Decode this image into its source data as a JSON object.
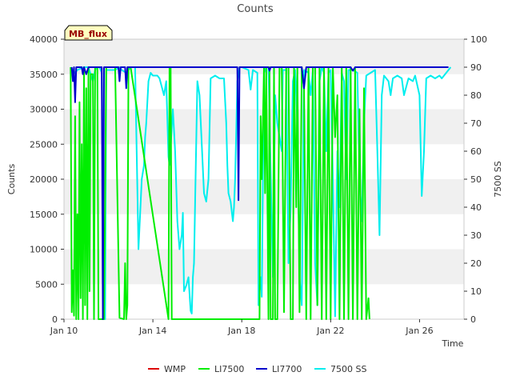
{
  "chart_data": {
    "type": "line",
    "title": "Counts",
    "xlabel": "Time",
    "ylabel": "Counts",
    "y2label": "7500 SS",
    "ylim": [
      0,
      40000
    ],
    "y2lim": [
      0,
      100
    ],
    "xlim": [
      10.0,
      28.0
    ],
    "x_units": "day of January",
    "yticks": [
      0,
      5000,
      10000,
      15000,
      20000,
      25000,
      30000,
      35000,
      40000
    ],
    "y2ticks": [
      0,
      10,
      20,
      30,
      40,
      50,
      60,
      70,
      80,
      90,
      100
    ],
    "xticks": [
      {
        "value": 10,
        "label": "Jan 10"
      },
      {
        "value": 14,
        "label": "Jan 14"
      },
      {
        "value": 18,
        "label": "Jan 18"
      },
      {
        "value": 22,
        "label": "Jan 22"
      },
      {
        "value": 26,
        "label": "Jan 26"
      }
    ],
    "grid": "horizontal bands",
    "legend_position": "bottom",
    "annotation": "MB_flux",
    "series": [
      {
        "name": "WMP",
        "color": "#dd0000",
        "axis": "left",
        "points": []
      },
      {
        "name": "LI7500",
        "color": "#00ee00",
        "axis": "left",
        "points": [
          [
            10.3,
            36000
          ],
          [
            10.35,
            1000
          ],
          [
            10.4,
            7000
          ],
          [
            10.45,
            500
          ],
          [
            10.5,
            29000
          ],
          [
            10.55,
            0
          ],
          [
            10.6,
            15000
          ],
          [
            10.65,
            0
          ],
          [
            10.7,
            31000
          ],
          [
            10.75,
            3000
          ],
          [
            10.8,
            25000
          ],
          [
            10.85,
            0
          ],
          [
            10.9,
            36000
          ],
          [
            10.95,
            2000
          ],
          [
            11.0,
            33000
          ],
          [
            11.05,
            0
          ],
          [
            11.1,
            36000
          ],
          [
            11.15,
            4000
          ],
          [
            11.2,
            35000
          ],
          [
            11.3,
            35000
          ],
          [
            11.35,
            0
          ],
          [
            11.4,
            36000
          ],
          [
            11.5,
            36000
          ],
          [
            11.55,
            0
          ],
          [
            11.8,
            0
          ],
          [
            11.9,
            36000
          ],
          [
            12.2,
            36000
          ],
          [
            12.3,
            36000
          ],
          [
            12.5,
            200
          ],
          [
            12.7,
            0
          ],
          [
            12.75,
            8000
          ],
          [
            12.8,
            0
          ],
          [
            12.85,
            2000
          ],
          [
            12.9,
            36000
          ],
          [
            13.0,
            36000
          ],
          [
            14.7,
            0
          ],
          [
            14.75,
            36000
          ],
          [
            14.8,
            36000
          ],
          [
            14.85,
            0
          ],
          [
            18.8,
            0
          ],
          [
            18.85,
            29000
          ],
          [
            18.9,
            20000
          ],
          [
            19.0,
            36000
          ],
          [
            19.05,
            18000
          ],
          [
            19.1,
            36000
          ],
          [
            19.2,
            0
          ],
          [
            19.25,
            36000
          ],
          [
            19.3,
            0
          ],
          [
            19.4,
            0
          ],
          [
            19.45,
            36000
          ],
          [
            19.5,
            0
          ],
          [
            19.6,
            0
          ],
          [
            19.7,
            36000
          ],
          [
            19.8,
            36000
          ],
          [
            19.9,
            1000
          ],
          [
            20.0,
            36000
          ],
          [
            20.1,
            36000
          ],
          [
            20.2,
            0
          ],
          [
            20.3,
            0
          ],
          [
            20.35,
            36000
          ],
          [
            20.45,
            16000
          ],
          [
            20.5,
            36000
          ],
          [
            20.6,
            1000
          ],
          [
            20.7,
            36000
          ],
          [
            20.8,
            33000
          ],
          [
            20.9,
            0
          ],
          [
            21.0,
            36000
          ],
          [
            21.1,
            0
          ],
          [
            21.2,
            36000
          ],
          [
            21.3,
            36000
          ],
          [
            21.4,
            2000
          ],
          [
            21.5,
            36000
          ],
          [
            21.6,
            0
          ],
          [
            21.7,
            36000
          ],
          [
            21.8,
            0
          ],
          [
            21.9,
            36000
          ],
          [
            22.0,
            0
          ],
          [
            22.1,
            36000
          ],
          [
            22.2,
            26000
          ],
          [
            22.3,
            32000
          ],
          [
            22.4,
            0
          ],
          [
            22.5,
            36000
          ],
          [
            22.6,
            0
          ],
          [
            22.7,
            36000
          ],
          [
            22.8,
            0
          ],
          [
            22.9,
            36000
          ],
          [
            23.0,
            0
          ],
          [
            23.1,
            36000
          ],
          [
            23.2,
            0
          ],
          [
            23.3,
            30000
          ],
          [
            23.4,
            0
          ],
          [
            23.5,
            33000
          ],
          [
            23.6,
            0
          ],
          [
            23.7,
            3000
          ],
          [
            23.75,
            0
          ]
        ]
      },
      {
        "name": "LI7700",
        "color": "#0000cc",
        "axis": "left",
        "points": [
          [
            10.35,
            36000
          ],
          [
            10.4,
            34000
          ],
          [
            10.45,
            36000
          ],
          [
            10.5,
            31000
          ],
          [
            10.55,
            36000
          ],
          [
            10.8,
            36000
          ],
          [
            10.85,
            35000
          ],
          [
            10.9,
            36000
          ],
          [
            11.0,
            35000
          ],
          [
            11.1,
            36000
          ],
          [
            11.2,
            36000
          ],
          [
            11.3,
            36000
          ],
          [
            11.5,
            36000
          ],
          [
            11.6,
            36000
          ],
          [
            11.7,
            36000
          ],
          [
            11.75,
            0
          ],
          [
            11.8,
            36000
          ],
          [
            12.45,
            36000
          ],
          [
            12.5,
            34000
          ],
          [
            12.55,
            36000
          ],
          [
            12.75,
            36000
          ],
          [
            12.8,
            33000
          ],
          [
            12.85,
            36000
          ],
          [
            17.8,
            36000
          ],
          [
            17.85,
            17000
          ],
          [
            17.9,
            36000
          ],
          [
            19.2,
            36000
          ],
          [
            19.25,
            35500
          ],
          [
            19.3,
            36000
          ],
          [
            20.7,
            36000
          ],
          [
            20.8,
            33000
          ],
          [
            20.9,
            36000
          ],
          [
            22.9,
            36000
          ],
          [
            23.0,
            35500
          ],
          [
            23.1,
            36000
          ],
          [
            27.3,
            36000
          ]
        ]
      },
      {
        "name": "7500 SS",
        "color": "#00eeee",
        "axis": "right",
        "points": [
          [
            10.3,
            90
          ],
          [
            10.5,
            88
          ],
          [
            10.6,
            89
          ],
          [
            10.9,
            90
          ],
          [
            11.1,
            90
          ],
          [
            11.3,
            85
          ],
          [
            11.4,
            89
          ],
          [
            11.5,
            90
          ],
          [
            11.6,
            90
          ],
          [
            11.7,
            88
          ],
          [
            11.8,
            10
          ],
          [
            11.85,
            0
          ],
          [
            11.9,
            89
          ],
          [
            12.3,
            89
          ],
          [
            12.5,
            90
          ],
          [
            12.6,
            89
          ],
          [
            12.8,
            88
          ],
          [
            13.0,
            90
          ],
          [
            13.2,
            90
          ],
          [
            13.35,
            25
          ],
          [
            13.5,
            50
          ],
          [
            13.6,
            55
          ],
          [
            13.65,
            65
          ],
          [
            13.7,
            70
          ],
          [
            13.8,
            85
          ],
          [
            13.9,
            88
          ],
          [
            14.0,
            87
          ],
          [
            14.2,
            87
          ],
          [
            14.3,
            86
          ],
          [
            14.5,
            80
          ],
          [
            14.6,
            85
          ],
          [
            14.7,
            58
          ],
          [
            14.75,
            55
          ],
          [
            14.9,
            75
          ],
          [
            15.0,
            60
          ],
          [
            15.1,
            35
          ],
          [
            15.2,
            25
          ],
          [
            15.3,
            30
          ],
          [
            15.35,
            38
          ],
          [
            15.4,
            10
          ],
          [
            15.5,
            12
          ],
          [
            15.6,
            15
          ],
          [
            15.7,
            3
          ],
          [
            15.75,
            2
          ],
          [
            15.8,
            15
          ],
          [
            15.85,
            20
          ],
          [
            16.0,
            85
          ],
          [
            16.1,
            80
          ],
          [
            16.3,
            45
          ],
          [
            16.4,
            42
          ],
          [
            16.5,
            50
          ],
          [
            16.6,
            86
          ],
          [
            16.8,
            87
          ],
          [
            17.0,
            86
          ],
          [
            17.2,
            86
          ],
          [
            17.3,
            70
          ],
          [
            17.35,
            55
          ],
          [
            17.4,
            45
          ],
          [
            17.5,
            42
          ],
          [
            17.6,
            35
          ],
          [
            17.65,
            40
          ],
          [
            17.7,
            50
          ],
          [
            17.8,
            85
          ],
          [
            17.9,
            90
          ],
          [
            18.0,
            90
          ],
          [
            18.3,
            89
          ],
          [
            18.4,
            82
          ],
          [
            18.5,
            89
          ],
          [
            18.7,
            88
          ],
          [
            18.75,
            5
          ],
          [
            18.85,
            15
          ],
          [
            18.9,
            8
          ],
          [
            19.0,
            88
          ],
          [
            19.1,
            90
          ],
          [
            19.2,
            90
          ],
          [
            19.4,
            15
          ],
          [
            19.5,
            80
          ],
          [
            19.6,
            70
          ],
          [
            19.8,
            60
          ],
          [
            19.85,
            89
          ],
          [
            20.0,
            89
          ],
          [
            20.1,
            20
          ],
          [
            20.2,
            40
          ],
          [
            20.3,
            85
          ],
          [
            20.4,
            89
          ],
          [
            20.5,
            70
          ],
          [
            20.6,
            15
          ],
          [
            20.7,
            5
          ],
          [
            20.8,
            89
          ],
          [
            21.0,
            88
          ],
          [
            21.1,
            80
          ],
          [
            21.2,
            89
          ],
          [
            21.3,
            20
          ],
          [
            21.4,
            5
          ],
          [
            21.5,
            85
          ],
          [
            21.6,
            90
          ],
          [
            21.7,
            88
          ],
          [
            21.8,
            60
          ],
          [
            21.9,
            88
          ],
          [
            22.0,
            89
          ],
          [
            22.1,
            50
          ],
          [
            22.2,
            1
          ],
          [
            22.3,
            60
          ],
          [
            22.4,
            40
          ],
          [
            22.5,
            88
          ],
          [
            22.6,
            85
          ],
          [
            22.7,
            50
          ],
          [
            22.8,
            89
          ],
          [
            23.0,
            89
          ],
          [
            23.2,
            88
          ],
          [
            23.3,
            50
          ],
          [
            23.4,
            35
          ],
          [
            23.5,
            70
          ],
          [
            23.6,
            87
          ],
          [
            23.8,
            88
          ],
          [
            24.0,
            89
          ],
          [
            24.1,
            60
          ],
          [
            24.2,
            30
          ],
          [
            24.3,
            80
          ],
          [
            24.4,
            87
          ],
          [
            24.6,
            85
          ],
          [
            24.7,
            80
          ],
          [
            24.8,
            86
          ],
          [
            25.0,
            87
          ],
          [
            25.2,
            86
          ],
          [
            25.3,
            80
          ],
          [
            25.5,
            86
          ],
          [
            25.7,
            85
          ],
          [
            25.8,
            87
          ],
          [
            26.0,
            80
          ],
          [
            26.1,
            44
          ],
          [
            26.2,
            60
          ],
          [
            26.3,
            86
          ],
          [
            26.5,
            87
          ],
          [
            26.7,
            86
          ],
          [
            26.9,
            87
          ],
          [
            27.0,
            86
          ],
          [
            27.1,
            87
          ],
          [
            27.3,
            89
          ],
          [
            27.4,
            90
          ]
        ]
      }
    ]
  }
}
